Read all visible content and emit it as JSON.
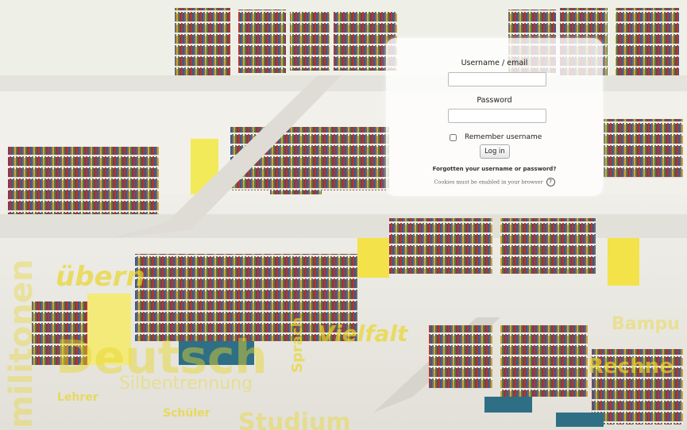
{
  "login": {
    "username_label": "Username / email",
    "password_label": "Password",
    "remember_label": "Remember username",
    "login_button": "Log in",
    "forgot_link": "Forgotten your username or password?",
    "cookies_notice": "Cookies must be enabled in your browser",
    "help_icon": "question-circle-icon"
  },
  "background_words": [
    "übern",
    "Deutsch",
    "Vielfalt",
    "Silbentrennung",
    "Sprach",
    "Lehrer",
    "Schüler",
    "Studium",
    "militonen",
    "Rechne",
    "Bampu"
  ],
  "colors": {
    "panel_bg": "#ffffff",
    "word_yellow": "#e8d62a"
  }
}
